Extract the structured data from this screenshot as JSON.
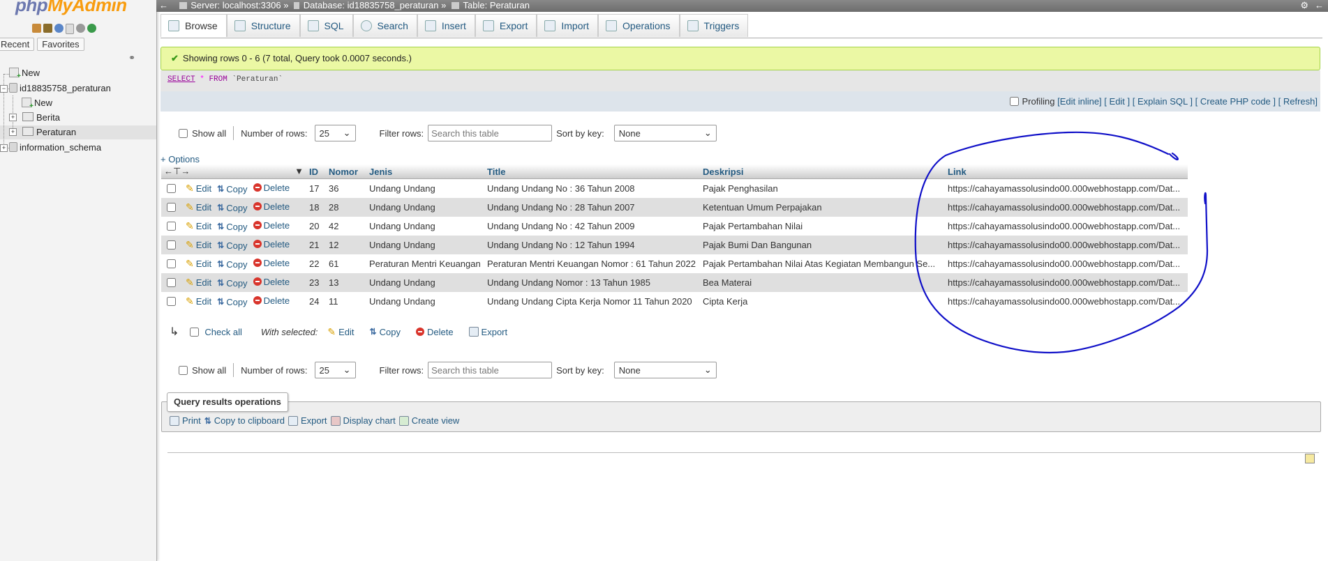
{
  "sidebar": {
    "logo": {
      "php": "php",
      "my": "My",
      "admin": "Admin"
    },
    "tabs": [
      "Recent",
      "Favorites"
    ],
    "tree": {
      "new": "New",
      "db1": "id18835758_peraturan",
      "db1_new": "New",
      "table1": "Berita",
      "table2": "Peraturan",
      "db2": "information_schema"
    }
  },
  "breadcrumb": {
    "server": "Server: localhost:3306",
    "database": "Database: id18835758_peraturan",
    "table": "Table: Peraturan",
    "sep": "»"
  },
  "tabs": [
    "Browse",
    "Structure",
    "SQL",
    "Search",
    "Insert",
    "Export",
    "Import",
    "Operations",
    "Triggers"
  ],
  "message": "Showing rows 0 - 6 (7 total, Query took 0.0007 seconds.)",
  "sql": {
    "select": "SELECT",
    "star": "*",
    "from": "FROM",
    "table": "`Peraturan`"
  },
  "sql_links": {
    "profiling": "Profiling",
    "edit_inline": "[Edit inline]",
    "edit": "[ Edit ]",
    "explain": "[ Explain SQL ]",
    "create_php": "[ Create PHP code ]",
    "refresh": "[ Refresh]"
  },
  "controls": {
    "show_all": "Show all",
    "number_of_rows": "Number of rows:",
    "rows_value": "25",
    "filter_rows": "Filter rows:",
    "filter_placeholder": "Search this table",
    "sort_by_key": "Sort by key:",
    "sort_value": "None"
  },
  "options": "+ Options",
  "columns": [
    "ID",
    "Nomor",
    "Jenis",
    "Title",
    "Deskripsi",
    "Link"
  ],
  "row_actions": {
    "edit": "Edit",
    "copy": "Copy",
    "delete": "Delete"
  },
  "rows": [
    {
      "id": "17",
      "nomor": "36",
      "jenis": "Undang Undang",
      "title": "Undang Undang No : 36 Tahun 2008",
      "deskripsi": "Pajak Penghasilan",
      "link": "https://cahayamassolusindo00.000webhostapp.com/Dat..."
    },
    {
      "id": "18",
      "nomor": "28",
      "jenis": "Undang Undang",
      "title": "Undang Undang No : 28 Tahun 2007",
      "deskripsi": "Ketentuan Umum Perpajakan",
      "link": "https://cahayamassolusindo00.000webhostapp.com/Dat..."
    },
    {
      "id": "20",
      "nomor": "42",
      "jenis": "Undang Undang",
      "title": "Undang Undang No : 42 Tahun 2009",
      "deskripsi": "Pajak Pertambahan Nilai",
      "link": "https://cahayamassolusindo00.000webhostapp.com/Dat..."
    },
    {
      "id": "21",
      "nomor": "12",
      "jenis": "Undang Undang",
      "title": "Undang Undang No : 12 Tahun 1994",
      "deskripsi": "Pajak Bumi Dan Bangunan",
      "link": "https://cahayamassolusindo00.000webhostapp.com/Dat..."
    },
    {
      "id": "22",
      "nomor": "61",
      "jenis": "Peraturan Mentri Keuangan",
      "title": "Peraturan Mentri Keuangan Nomor : 61 Tahun 2022",
      "deskripsi": "Pajak Pertambahan Nilai Atas Kegiatan Membangun Se...",
      "link": "https://cahayamassolusindo00.000webhostapp.com/Dat..."
    },
    {
      "id": "23",
      "nomor": "13",
      "jenis": "Undang Undang",
      "title": "Undang Undang Nomor : 13 Tahun 1985",
      "deskripsi": "Bea Materai",
      "link": "https://cahayamassolusindo00.000webhostapp.com/Dat..."
    },
    {
      "id": "24",
      "nomor": "11",
      "jenis": "Undang Undang",
      "title": "Undang Undang Cipta Kerja Nomor 11 Tahun 2020",
      "deskripsi": "Cipta Kerja",
      "link": "https://cahayamassolusindo00.000webhostapp.com/Dat..."
    }
  ],
  "with_selected": {
    "check_all": "Check all",
    "label": "With selected:",
    "edit": "Edit",
    "copy": "Copy",
    "delete": "Delete",
    "export": "Export"
  },
  "query_ops": {
    "legend": "Query results operations",
    "print": "Print",
    "copy_clipboard": "Copy to clipboard",
    "export": "Export",
    "display_chart": "Display chart",
    "create_view": "Create view"
  },
  "colors": {
    "link": "#235a81",
    "success_bg": "#ebf8a4",
    "annotation": "#1010c8"
  }
}
